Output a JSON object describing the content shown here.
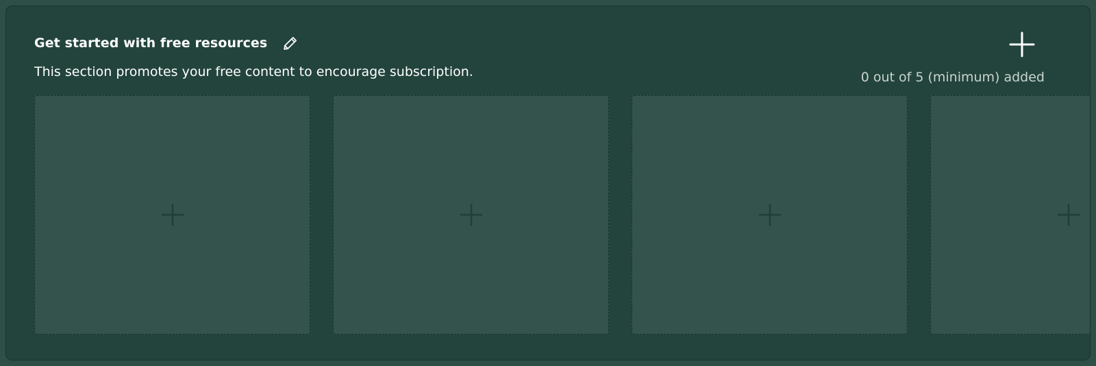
{
  "section": {
    "title": "Get started with free resources",
    "description": "This section promotes your free content to encourage subscription.",
    "counter": "0 out of 5 (minimum) added"
  },
  "icons": {
    "edit": "pencil-icon",
    "add": "plus-icon",
    "slot": "plus-icon"
  },
  "slots": [
    {
      "state": "empty"
    },
    {
      "state": "empty"
    },
    {
      "state": "empty"
    },
    {
      "state": "empty"
    }
  ],
  "colors": {
    "page_background": "#2e4f47",
    "panel_background": "#23443c",
    "slot_background": "#33534c",
    "slot_border": "#15302a",
    "text_primary": "#ffffff",
    "text_secondary": "#c9d4d0",
    "slot_icon": "#1f3f37"
  }
}
